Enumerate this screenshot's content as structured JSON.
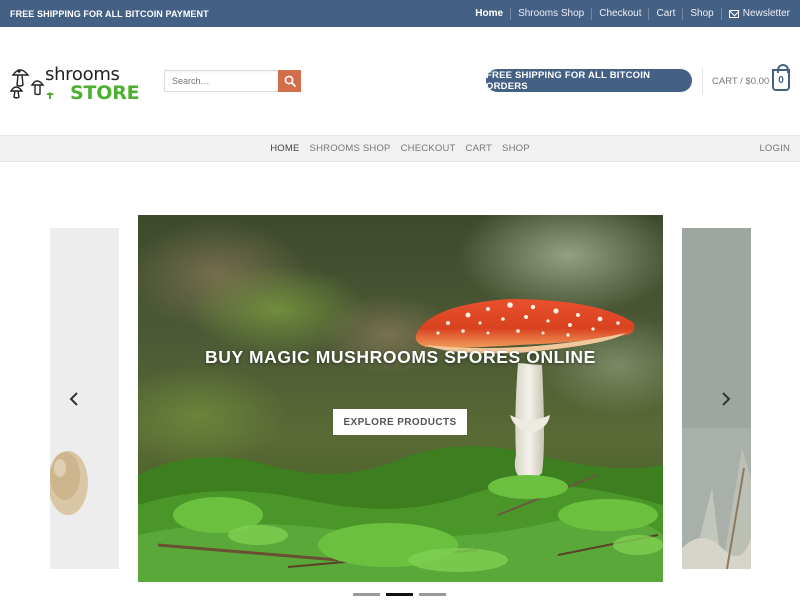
{
  "topbar": {
    "message": "FREE SHIPPING FOR ALL BITCOIN PAYMENT",
    "nav": [
      "Home",
      "Shrooms Shop",
      "Checkout",
      "Cart",
      "Shop"
    ],
    "newsletter": "Newsletter"
  },
  "header": {
    "logo_top": "shrooms",
    "logo_bottom": "STORE",
    "search_placeholder": "Search…",
    "promo": "FREE SHIPPING FOR ALL BITCOIN ORDERS",
    "cart_label": "CART / $0.00",
    "cart_count": "0"
  },
  "mainnav": {
    "items": [
      "HOME",
      "SHROOMS SHOP",
      "CHECKOUT",
      "CART",
      "SHOP"
    ],
    "login": "LOGIN"
  },
  "hero": {
    "title": "BUY MAGIC MUSHROOMS SPORES ONLINE",
    "button": "EXPLORE PRODUCTS"
  },
  "slider": {
    "slide_count": 3,
    "active_index": 1
  },
  "colors": {
    "primary": "#446084",
    "accent": "#d26e4b",
    "logo_green": "#4caf2f"
  }
}
